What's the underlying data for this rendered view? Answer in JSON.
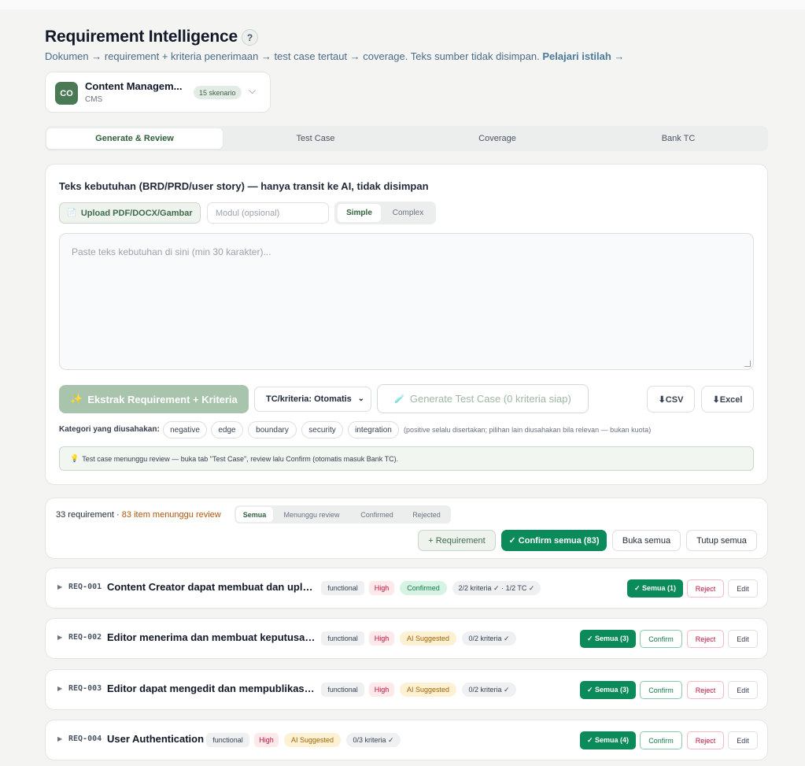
{
  "page": {
    "title": "Requirement Intelligence",
    "help_glyph": "?",
    "subtitle": "Dokumen → requirement + kriteria penerimaan → test case tertaut → coverage. Teks sumber tidak disimpan.",
    "subtitle_link": "Pelajari istilah →"
  },
  "project": {
    "logo_text": "CO",
    "name": "Content Managem...",
    "code": "CMS",
    "scenario_badge": "15 skenario",
    "chevron_glyph": "⌵"
  },
  "tabs": [
    "Generate & Review",
    "Test Case",
    "Coverage",
    "Bank TC"
  ],
  "generate": {
    "section_label": "Teks kebutuhan (BRD/PRD/user story) — hanya transit ke AI, tidak disimpan",
    "upload_icon": "📄",
    "upload_label": "Upload PDF/DOCX/Gambar",
    "modul_placeholder": "Modul (opsional)",
    "mode_options": [
      "Simple",
      "Complex"
    ],
    "textarea_placeholder": "Paste teks kebutuhan di sini (min 30 karakter)...",
    "extract_icon": "✨",
    "extract_label": "Ekstrak Requirement + Kriteria",
    "tc_select": "TC/kriteria: Otomatis",
    "select_caret": "⌄",
    "generate_icon": "🧪",
    "generate_label": "Generate Test Case (0 kriteria siap)",
    "csv_label": "⬇CSV",
    "excel_label": "⬇Excel",
    "categories_label": "Kategori yang diusahakan:",
    "categories": [
      "negative",
      "edge",
      "boundary",
      "security",
      "integration"
    ],
    "categories_note": "(positive selalu disertakan; pilihan lain diusahakan bila relevan — bukan kuota)",
    "info_icon": "💡",
    "info_text": "Test case menunggu review — buka tab \"Test Case\", review lalu Confirm (otomatis masuk Bank TC)."
  },
  "summary": {
    "requirement_count": "33 requirement",
    "separator": " · ",
    "pending": "83 item menunggu review",
    "filters": [
      "Semua",
      "Menunggu review",
      "Confirmed",
      "Rejected"
    ],
    "add_requirement": "+ Requirement",
    "confirm_all": "✓ Confirm semua (83)",
    "open_all": "Buka semua",
    "close_all": "Tutup semua"
  },
  "requirements": [
    {
      "toggle": "▶",
      "id": "REQ-001",
      "title": "Content Creator dapat membuat dan uplo...",
      "type": "functional",
      "priority": "High",
      "status": "Confirmed",
      "criteria": "2/2 kriteria ✓ · 1/2 TC ✓",
      "semua": "✓ Semua (1)",
      "reject": "Reject",
      "edit": "Edit"
    },
    {
      "toggle": "▶",
      "id": "REQ-002",
      "title": "Editor menerima dan membuat keputusan...",
      "type": "functional",
      "priority": "High",
      "status": "AI Suggested",
      "criteria": "0/2 kriteria ✓",
      "semua": "✓ Semua (3)",
      "confirm": "Confirm",
      "reject": "Reject",
      "edit": "Edit"
    },
    {
      "toggle": "▶",
      "id": "REQ-003",
      "title": "Editor dapat mengedit dan mempublikasik...",
      "type": "functional",
      "priority": "High",
      "status": "AI Suggested",
      "criteria": "0/2 kriteria ✓",
      "semua": "✓ Semua (3)",
      "confirm": "Confirm",
      "reject": "Reject",
      "edit": "Edit"
    },
    {
      "toggle": "▶",
      "id": "REQ-004",
      "title": "User Authentication",
      "type": "functional",
      "priority": "High",
      "status": "AI Suggested",
      "criteria": "0/3 kriteria ✓",
      "semua": "✓ Semua (4)",
      "confirm": "Confirm",
      "reject": "Reject",
      "edit": "Edit"
    }
  ]
}
